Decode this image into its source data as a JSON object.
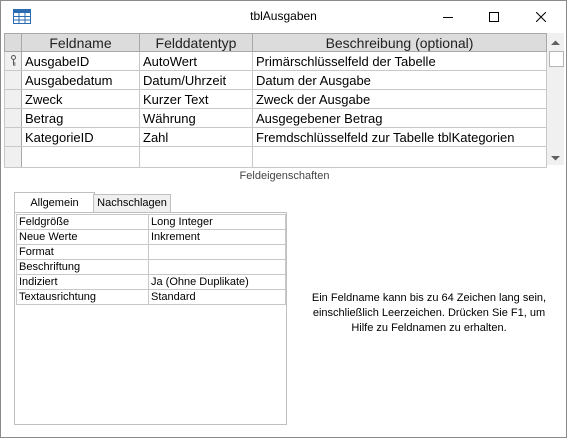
{
  "window": {
    "title": "tblAusgaben"
  },
  "icons": {
    "app": "table-icon",
    "minimize": "minimize-icon",
    "maximize": "maximize-icon",
    "close": "close-icon",
    "primary_key": "key-icon",
    "scroll_up": "chevron-up-icon",
    "scroll_down": "chevron-down-icon"
  },
  "design_grid": {
    "headers": {
      "field_name": "Feldname",
      "data_type": "Felddatentyp",
      "description": "Beschreibung (optional)"
    },
    "rows": [
      {
        "field_name": "AusgabeID",
        "data_type": "AutoWert",
        "description": "Primärschlüsselfeld der Tabelle",
        "primary_key": true
      },
      {
        "field_name": "Ausgabedatum",
        "data_type": "Datum/Uhrzeit",
        "description": "Datum der Ausgabe",
        "primary_key": false
      },
      {
        "field_name": "Zweck",
        "data_type": "Kurzer Text",
        "description": "Zweck der Ausgabe",
        "primary_key": false
      },
      {
        "field_name": "Betrag",
        "data_type": "Währung",
        "description": "Ausgegebener Betrag",
        "primary_key": false
      },
      {
        "field_name": "KategorieID",
        "data_type": "Zahl",
        "description": "Fremdschlüsselfeld zur Tabelle tblKategorien",
        "primary_key": false
      }
    ]
  },
  "field_properties": {
    "section_label": "Feldeigenschaften",
    "tabs": [
      {
        "label": "Allgemein",
        "active": true
      },
      {
        "label": "Nachschlagen",
        "active": false
      }
    ],
    "rows": [
      {
        "name": "Feldgröße",
        "value": "Long Integer"
      },
      {
        "name": "Neue Werte",
        "value": "Inkrement"
      },
      {
        "name": "Format",
        "value": ""
      },
      {
        "name": "Beschriftung",
        "value": ""
      },
      {
        "name": "Indiziert",
        "value": "Ja (Ohne Duplikate)"
      },
      {
        "name": "Textausrichtung",
        "value": "Standard"
      }
    ],
    "help_text": "Ein Feldname kann bis zu 64 Zeichen lang sein, einschließlich Leerzeichen. Drücken Sie F1, um Hilfe zu Feldnamen zu erhalten."
  },
  "colors": {
    "header_bg": "#dcdcdc",
    "grid_line": "#c8c8c8",
    "scrollbar_bg": "#f0f0f0"
  }
}
